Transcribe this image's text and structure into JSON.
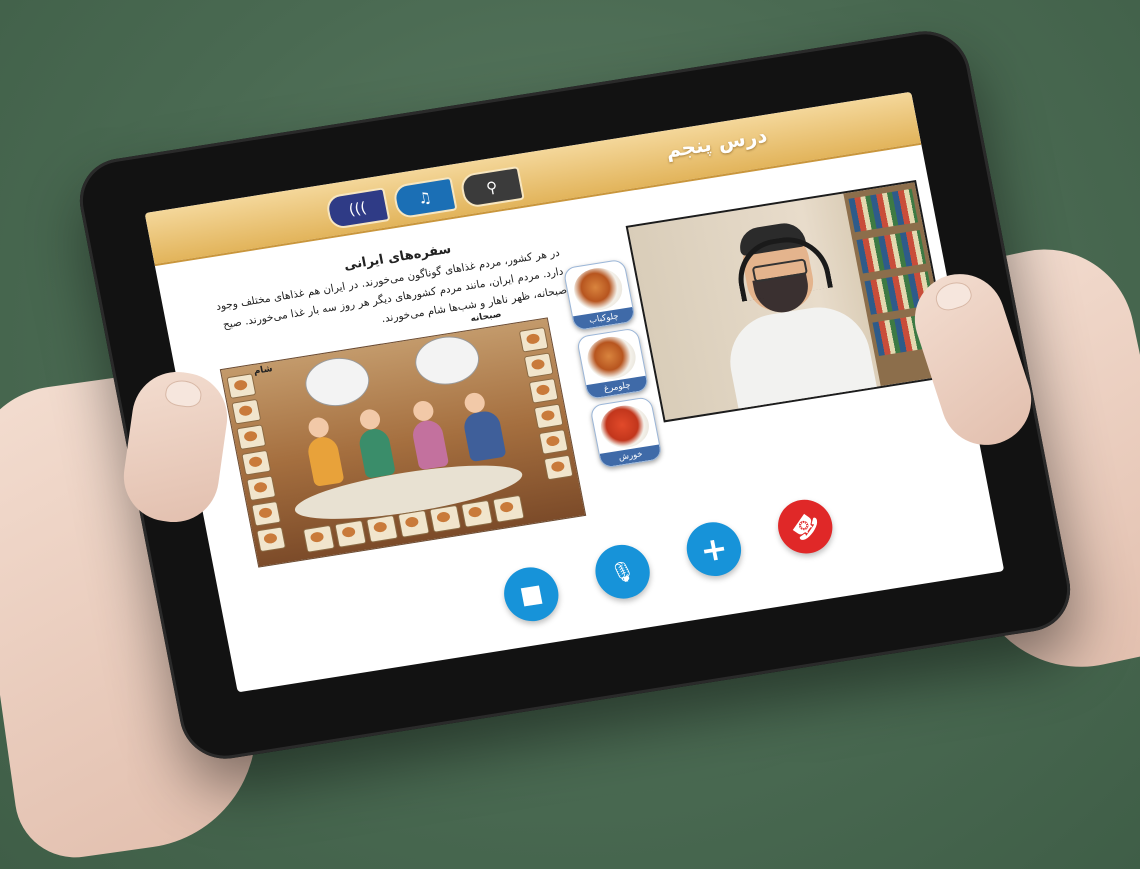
{
  "lesson": {
    "title": "درس پنجم"
  },
  "tabs": [
    {
      "icon": "audio-waves-icon",
      "glyph": "((("
    },
    {
      "icon": "headphones-icon",
      "glyph": "♫"
    },
    {
      "icon": "magnifier-icon",
      "glyph": "⚲"
    }
  ],
  "article": {
    "title": "سفره‌های ایرانی",
    "body": "در هر کشور، مردم غذاهای گوناگون می‌خورند. در ایران هم غذاهای مختلف وجود دارد. مردم ایران، مانند مردم کشورهای دیگر هر روز سه بار غذا می‌خورند. صبح صبحانه، ظهر ناهار و شب‌ها شام می‌خورند.",
    "label_dinner": "شام",
    "label_breakfast": "صبحانه"
  },
  "food_menu": [
    {
      "caption": "چلوکباب"
    },
    {
      "caption": "چلومرغ"
    },
    {
      "caption": "خورش"
    }
  ],
  "call_controls": [
    {
      "name": "video-camera-button",
      "icon": "video-camera-icon",
      "glyph": "■",
      "color": "#1793d9"
    },
    {
      "name": "microphone-button",
      "icon": "microphone-icon",
      "glyph": "🎙",
      "color": "#1793d9"
    },
    {
      "name": "add-participant-button",
      "icon": "plus-icon",
      "glyph": "+",
      "color": "#1793d9"
    },
    {
      "name": "end-call-button",
      "icon": "hang-up-icon",
      "glyph": "☎",
      "color": "#e02828"
    }
  ],
  "colors": {
    "banner": "#e2b45b",
    "call_blue": "#1793d9",
    "end_red": "#e02828"
  }
}
